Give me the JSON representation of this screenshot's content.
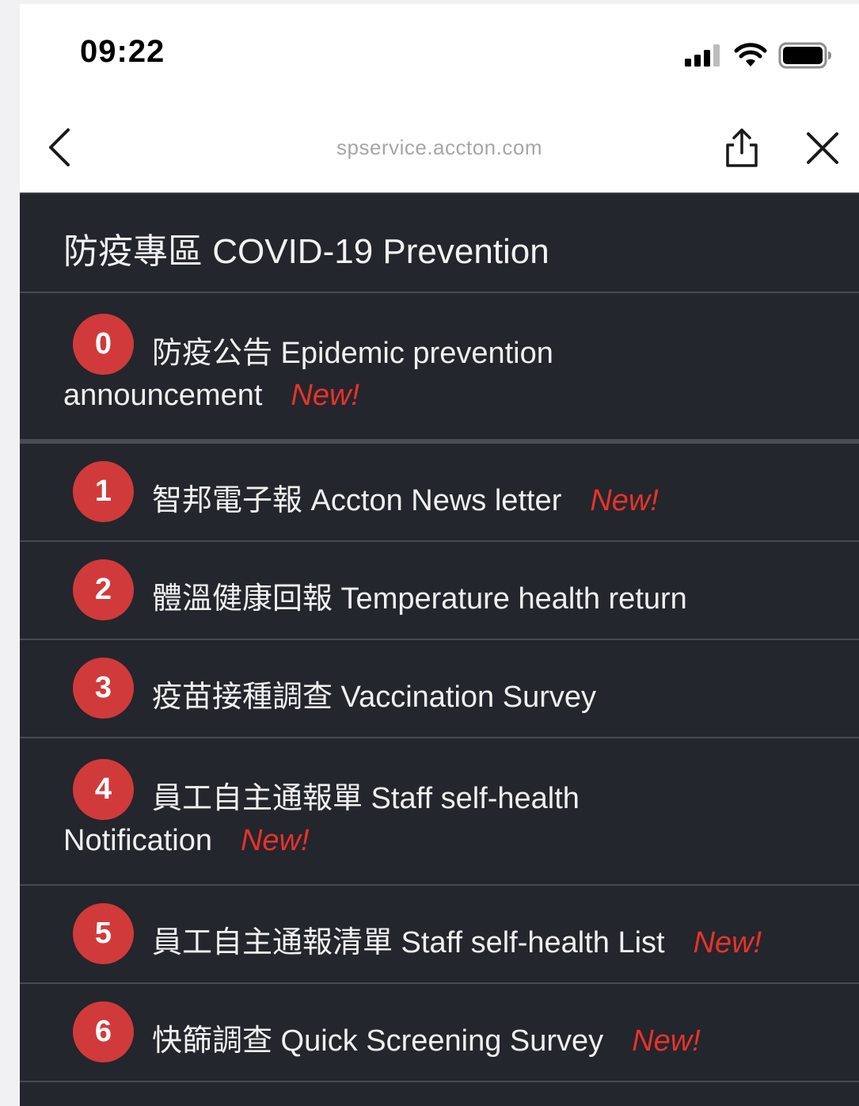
{
  "status_bar": {
    "time": "09:22",
    "signal_icon": "cellular-signal-icon",
    "wifi_icon": "wifi-icon",
    "battery_icon": "battery-icon"
  },
  "browser": {
    "url": "spservice.accton.com",
    "back_icon": "chevron-left-icon",
    "share_icon": "share-icon",
    "close_icon": "close-icon"
  },
  "page": {
    "title": "防疫專區 COVID-19 Prevention",
    "new_label": "New!",
    "items": [
      {
        "number": "0",
        "line1": "防疫公告 Epidemic prevention",
        "line2": "announcement",
        "is_new": true
      },
      {
        "number": "1",
        "line1": "智邦電子報 Accton News letter",
        "is_new": true
      },
      {
        "number": "2",
        "line1": "體溫健康回報 Temperature health return",
        "is_new": false
      },
      {
        "number": "3",
        "line1": "疫苗接種調查 Vaccination Survey",
        "is_new": false
      },
      {
        "number": "4",
        "line1": "員工自主通報單 Staff self-health",
        "line2": "Notification",
        "is_new": true
      },
      {
        "number": "5",
        "line1": "員工自主通報清單 Staff self-health List",
        "is_new": true
      },
      {
        "number": "6",
        "line1": "快篩調查 Quick Screening Survey",
        "is_new": true
      }
    ]
  },
  "colors": {
    "background": "#23262d",
    "badge": "#d13a3a",
    "new_tag": "#e8322a",
    "divider": "#474a50"
  }
}
